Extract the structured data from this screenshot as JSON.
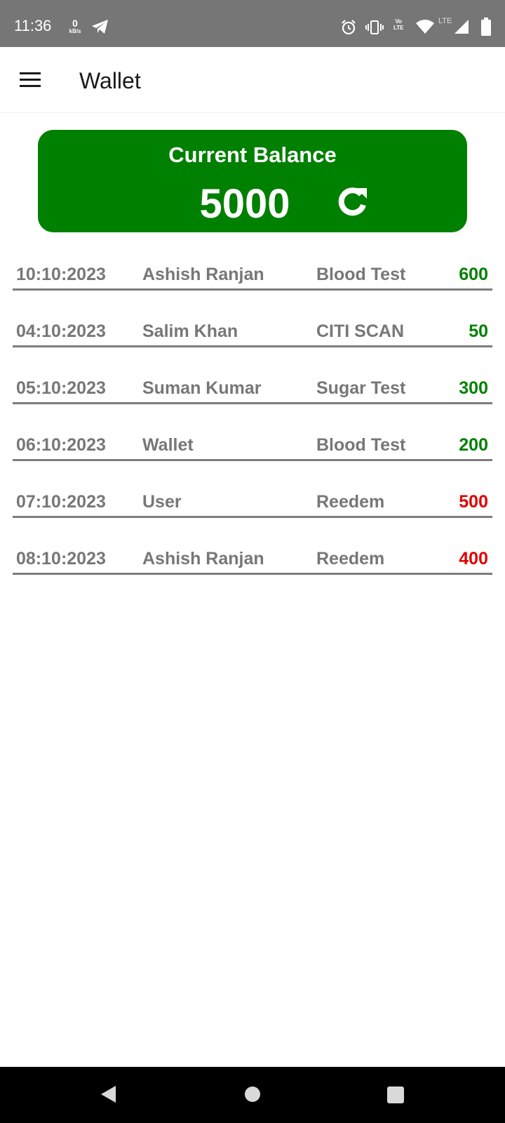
{
  "status_bar": {
    "time": "11:36",
    "speed_value": "0",
    "speed_unit": "kB/s",
    "volte_top": "Vo",
    "volte_bottom": "LTE",
    "lte_label": "LTE"
  },
  "app_bar": {
    "title": "Wallet"
  },
  "balance": {
    "title": "Current Balance",
    "amount": "5000"
  },
  "colors": {
    "brand_green": "#008000",
    "credit": "#008000",
    "debit": "#e00000",
    "text_muted": "#777777"
  },
  "transactions": [
    {
      "date": "10:10:2023",
      "name": "Ashish Ranjan",
      "type": "Blood Test",
      "amount": "600",
      "kind": "credit"
    },
    {
      "date": "04:10:2023",
      "name": "Salim Khan",
      "type": "CITI SCAN",
      "amount": "50",
      "kind": "credit"
    },
    {
      "date": "05:10:2023",
      "name": "Suman Kumar",
      "type": "Sugar Test",
      "amount": "300",
      "kind": "credit"
    },
    {
      "date": "06:10:2023",
      "name": "Wallet",
      "type": "Blood Test",
      "amount": "200",
      "kind": "credit"
    },
    {
      "date": "07:10:2023",
      "name": "User",
      "type": "Reedem",
      "amount": "500",
      "kind": "debit"
    },
    {
      "date": "08:10:2023",
      "name": "Ashish Ranjan",
      "type": "Reedem",
      "amount": "400",
      "kind": "debit"
    }
  ],
  "icons": {
    "menu": "hamburger-menu-icon",
    "refresh": "refresh-icon",
    "nav_back": "back-triangle-icon",
    "nav_home": "home-circle-icon",
    "nav_recents": "recents-square-icon"
  }
}
